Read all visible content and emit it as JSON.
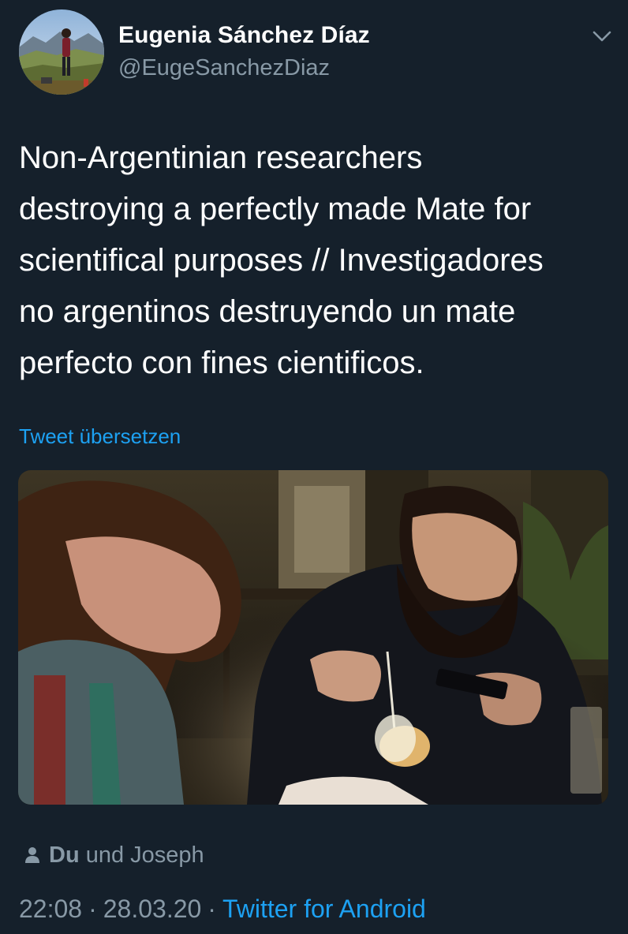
{
  "author": {
    "name": "Eugenia Sánchez Díaz",
    "handle": "@EugeSanchezDiaz"
  },
  "tweet": {
    "lines": [
      "Non-Argentinian researchers",
      "destroying a perfectly made Mate for",
      "scientifical purposes // Investigadores",
      "no argentinos destruyendo un mate",
      "perfecto con fines cientificos."
    ],
    "translate_label": "Tweet übersetzen"
  },
  "tagged": {
    "first": "Du",
    "rest": " und Joseph"
  },
  "meta": {
    "time": "22:08",
    "date": "28.03.20",
    "separator": "·",
    "source": "Twitter for Android"
  },
  "colors": {
    "background": "#15202b",
    "primary_text": "#ffffff",
    "secondary_text": "#8899a6",
    "link": "#1da1f2"
  },
  "icons": {
    "menu": "chevron-down-icon",
    "tagged": "person-icon"
  }
}
